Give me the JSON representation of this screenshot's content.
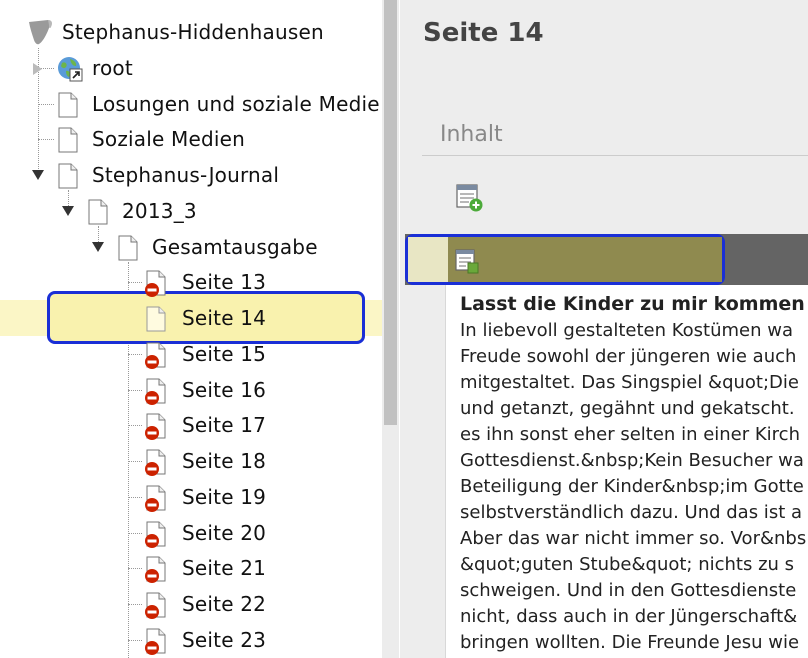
{
  "tree": {
    "root_site": "Stephanus-Hiddenhausen",
    "items": [
      {
        "label": "root",
        "icon": "globe-link-icon"
      },
      {
        "label": "Losungen und soziale Medie",
        "icon": "page-icon"
      },
      {
        "label": "Soziale Medien",
        "icon": "page-icon"
      },
      {
        "label": "Stephanus-Journal",
        "icon": "page-icon"
      },
      {
        "label": "2013_3",
        "icon": "page-icon"
      },
      {
        "label": "Gesamtausgabe",
        "icon": "page-icon"
      },
      {
        "label": "Seite 13",
        "icon": "page-hidden-icon"
      },
      {
        "label": "Seite 14",
        "icon": "page-icon"
      },
      {
        "label": "Seite 15",
        "icon": "page-hidden-icon"
      },
      {
        "label": "Seite 16",
        "icon": "page-hidden-icon"
      },
      {
        "label": "Seite 17",
        "icon": "page-hidden-icon"
      },
      {
        "label": "Seite 18",
        "icon": "page-hidden-icon"
      },
      {
        "label": "Seite 19",
        "icon": "page-hidden-icon"
      },
      {
        "label": "Seite 20",
        "icon": "page-hidden-icon"
      },
      {
        "label": "Seite 21",
        "icon": "page-hidden-icon"
      },
      {
        "label": "Seite 22",
        "icon": "page-hidden-icon"
      },
      {
        "label": "Seite 23",
        "icon": "page-hidden-icon"
      }
    ],
    "selected_label": "Seite 14"
  },
  "content": {
    "page_title": "Seite 14",
    "tab_label": "Inhalt",
    "element_title": "Lasst die Kinder zu mir kommen",
    "element_lines": [
      "In liebevoll gestalteten Kostümen wa",
      "Freude sowohl der jüngeren wie auch",
      "mitgestaltet. Das Singspiel &quot;Die",
      "und getanzt, gegähnt und gekatscht.",
      "es ihn sonst eher selten in einer Kirch",
      "Gottesdienst.&nbsp;Kein Besucher wa",
      "Beteiligung der Kinder&nbsp;im Gotte",
      "selbstverständlich dazu. Und das ist a",
      "Aber das war nicht immer so. Vor&nbs",
      "&quot;guten Stube&quot; nichts zu s",
      "schweigen. Und in den Gottesdienste",
      "nicht, dass auch in der Jüngerschaft&",
      "bringen wollten. Die Freunde Jesu wie"
    ]
  },
  "colors": {
    "selection_outline": "#1a2fd6",
    "selected_row": "#f9f2ae",
    "content_header": "#8e8a4d",
    "hidden_badge": "#cc2200"
  }
}
